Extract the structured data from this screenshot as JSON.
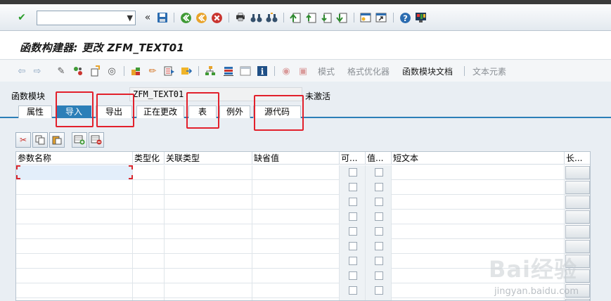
{
  "std_toolbar": {
    "command_field_value": "",
    "icons": [
      "ok-check-icon",
      "collapse-icon",
      "save-icon",
      "back-icon",
      "exit-icon",
      "cancel-icon",
      "print-icon",
      "find-icon",
      "find-next-icon",
      "first-page-icon",
      "prev-page-icon",
      "next-page-icon",
      "last-page-icon",
      "new-session-icon",
      "shortcut-icon",
      "help-icon",
      "customize-layout-icon"
    ]
  },
  "title": "函数构建器: 更改 ZFM_TEXT01",
  "app_toolbar": {
    "text_buttons": [
      {
        "label": "模式",
        "enabled": false
      },
      {
        "label": "格式优化器",
        "enabled": false
      },
      {
        "label": "函数模块文档",
        "enabled": true
      },
      {
        "label": "文本元素",
        "enabled": false
      }
    ]
  },
  "function_module": {
    "label": "函数模块",
    "value": "ZFM_TEXT01",
    "status": "未激活"
  },
  "tabs": [
    {
      "label": "属性",
      "active": false
    },
    {
      "label": "导入",
      "active": true
    },
    {
      "label": "导出",
      "active": false
    },
    {
      "label": "正在更改",
      "active": false
    },
    {
      "label": "表",
      "active": false
    },
    {
      "label": "例外",
      "active": false
    },
    {
      "label": "源代码",
      "active": false
    }
  ],
  "table": {
    "columns": [
      "参数名称",
      "类型化",
      "关联类型",
      "缺省值",
      "可...",
      "值...",
      "短文本",
      "长..."
    ],
    "row_count": 10
  },
  "watermark": {
    "text": "Bai经验",
    "sub": "jingyan.baidu.com"
  },
  "colors": {
    "accent": "#2c7fb8",
    "highlight_box": "#e2202b"
  }
}
